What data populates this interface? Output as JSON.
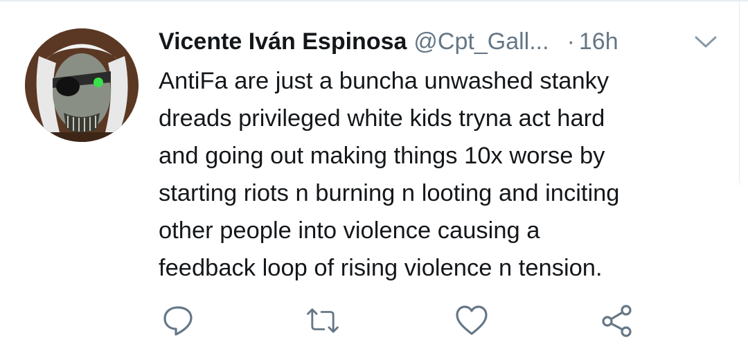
{
  "tweet": {
    "author_name": "Vicente Iván Espinosa",
    "author_handle": "@Cpt_Gall...",
    "separator": "·",
    "timestamp": "16h",
    "text_lines": [
      "AntiFa are just a buncha unwashed stanky",
      "dreads privileged white kids tryna act hard",
      "and going out making things 10x  worse by",
      "starting riots n burning n looting and inciting",
      "other people into violence causing a",
      "feedback loop of rising violence n tension."
    ]
  },
  "icons": {
    "menu": "chevron-down-icon",
    "reply": "reply-icon",
    "retweet": "retweet-icon",
    "like": "heart-icon",
    "share": "share-icon"
  },
  "colors": {
    "text": "#14171a",
    "secondary": "#657786",
    "divider": "#e6ecf0"
  }
}
